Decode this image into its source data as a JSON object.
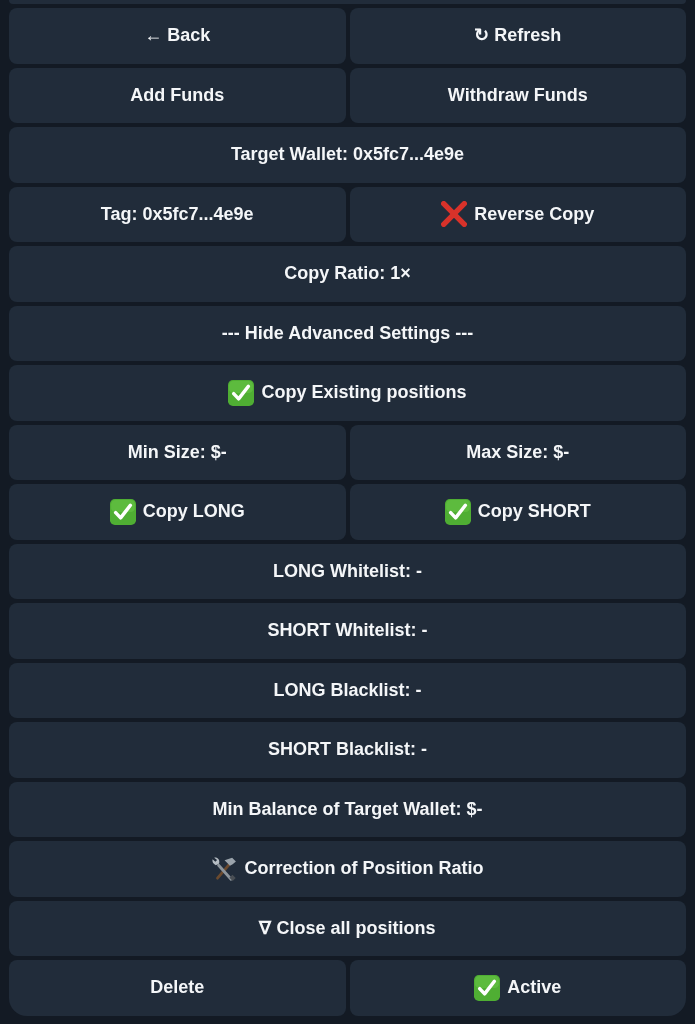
{
  "keyboard": {
    "rows": [
      {
        "buttons": [
          {
            "kind": "plain",
            "label": "← Back"
          },
          {
            "kind": "plain",
            "label": "↻ Refresh"
          }
        ]
      },
      {
        "buttons": [
          {
            "kind": "plain",
            "label": "Add Funds"
          },
          {
            "kind": "plain",
            "label": "Withdraw Funds"
          }
        ]
      },
      {
        "buttons": [
          {
            "kind": "plain",
            "label": "Target Wallet: 0x5fc7...4e9e"
          }
        ]
      },
      {
        "buttons": [
          {
            "kind": "plain",
            "label": "Tag: 0x5fc7...4e9e"
          },
          {
            "kind": "toggle",
            "label": "Reverse Copy",
            "checked": false
          }
        ]
      },
      {
        "buttons": [
          {
            "kind": "plain",
            "label": "Copy Ratio: 1×"
          }
        ]
      },
      {
        "buttons": [
          {
            "kind": "plain",
            "label": "--- Hide Advanced Settings ---"
          }
        ]
      },
      {
        "buttons": [
          {
            "kind": "toggle",
            "label": "Copy Existing positions",
            "checked": true
          }
        ]
      },
      {
        "buttons": [
          {
            "kind": "plain",
            "label": "Min Size: $-"
          },
          {
            "kind": "plain",
            "label": "Max Size: $-"
          }
        ]
      },
      {
        "buttons": [
          {
            "kind": "toggle",
            "label": "Copy LONG",
            "checked": true
          },
          {
            "kind": "toggle",
            "label": "Copy SHORT",
            "checked": true
          }
        ]
      },
      {
        "buttons": [
          {
            "kind": "plain",
            "label": "LONG Whitelist: -"
          }
        ]
      },
      {
        "buttons": [
          {
            "kind": "plain",
            "label": "SHORT Whitelist: -"
          }
        ]
      },
      {
        "buttons": [
          {
            "kind": "plain",
            "label": "LONG Blacklist: -"
          }
        ]
      },
      {
        "buttons": [
          {
            "kind": "plain",
            "label": "SHORT Blacklist: -"
          }
        ]
      },
      {
        "buttons": [
          {
            "kind": "plain",
            "label": "Min Balance of Target Wallet: $-"
          }
        ]
      },
      {
        "buttons": [
          {
            "kind": "tool",
            "label": "Correction of Position Ratio"
          }
        ]
      },
      {
        "buttons": [
          {
            "kind": "plain",
            "label": "∇ Close all positions"
          }
        ]
      },
      {
        "buttons": [
          {
            "kind": "plain",
            "label": "Delete"
          },
          {
            "kind": "toggle",
            "label": "Active",
            "checked": true
          }
        ]
      }
    ]
  }
}
